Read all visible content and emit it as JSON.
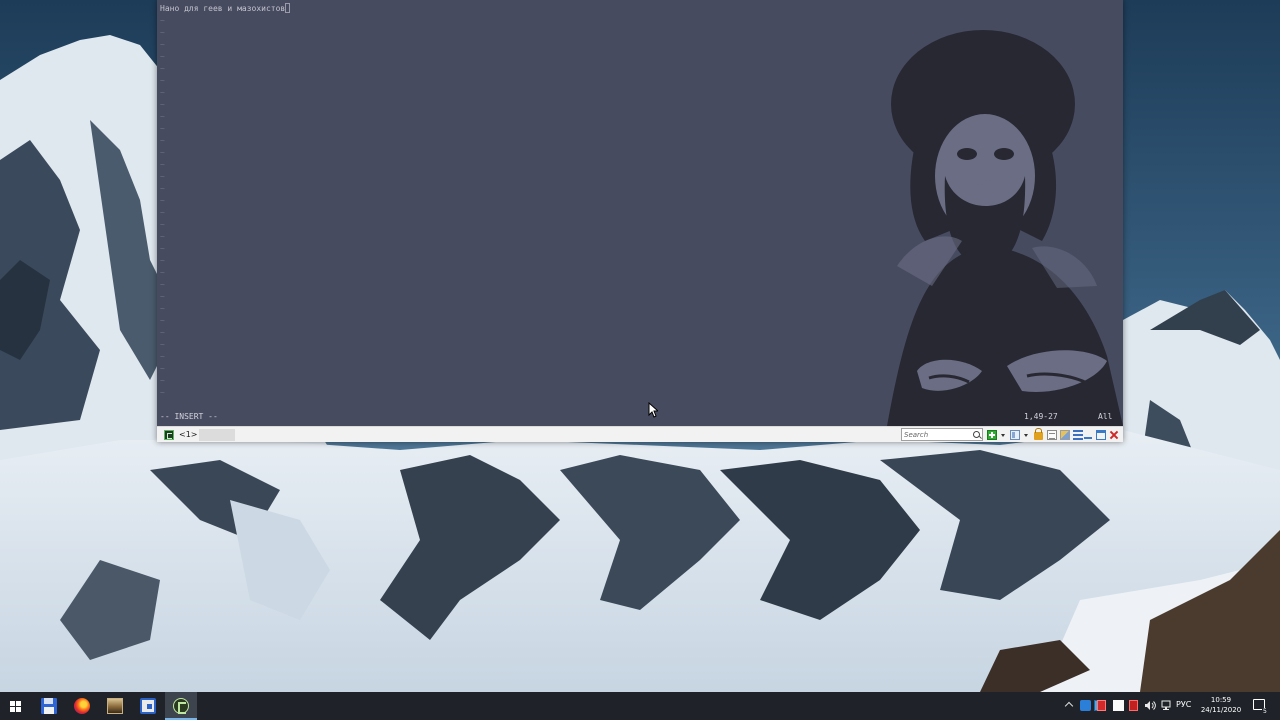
{
  "editor": {
    "line1": "Нано для геев и мазохистов",
    "tilde": "~",
    "mode": "-- INSERT --",
    "position": "1,49-27",
    "scroll": "All"
  },
  "tabbar": {
    "tab_label": "<1>",
    "search_placeholder": "Search"
  },
  "taskbar": {
    "lang": "РУС",
    "time": "10:59",
    "date": "24/11/2020",
    "notification_count": "5",
    "pinned": [
      "floppy-disk-icon",
      "firefox-icon",
      "photo-viewer-icon",
      "remote-desktop-icon",
      "conemu-icon"
    ]
  },
  "colors": {
    "terminal_bg": "#474b60",
    "portrait_dark": "#272832",
    "portrait_mid": "#6a6d84",
    "taskbar_bg": "#1f2329",
    "accent": "#79b4e8"
  }
}
